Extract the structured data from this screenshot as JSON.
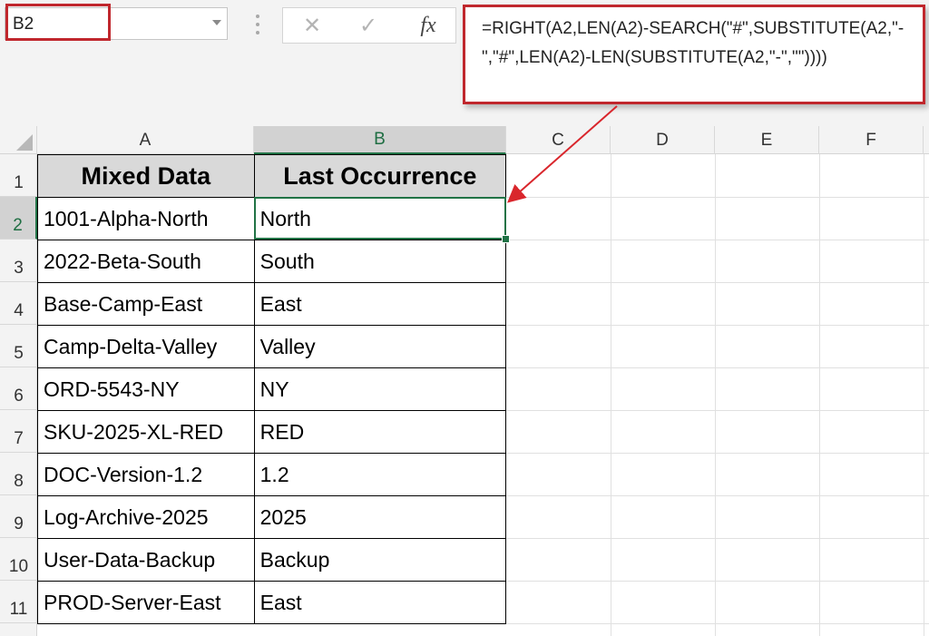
{
  "name_box": {
    "value": "B2"
  },
  "formula_bar": {
    "cancel_glyph": "✕",
    "enter_glyph": "✓",
    "function_glyph": "fx",
    "formula": "=RIGHT(A2,LEN(A2)-SEARCH(\"#\",SUBSTITUTE(A2,\"-\",\"#\",LEN(A2)-LEN(SUBSTITUTE(A2,\"-\",\"\"))))"
  },
  "column_headers": [
    "A",
    "B",
    "C",
    "D",
    "E",
    "F"
  ],
  "row_headers": [
    "1",
    "2",
    "3",
    "4",
    "5",
    "6",
    "7",
    "8",
    "9",
    "10",
    "11"
  ],
  "table": {
    "header": {
      "colA": "Mixed Data",
      "colB": "Last Occurrence"
    },
    "rows": [
      {
        "colA": "1001-Alpha-North",
        "colB": "North"
      },
      {
        "colA": "2022-Beta-South",
        "colB": "South"
      },
      {
        "colA": "Base-Camp-East",
        "colB": "East"
      },
      {
        "colA": "Camp-Delta-Valley",
        "colB": "Valley"
      },
      {
        "colA": "ORD-5543-NY",
        "colB": "NY"
      },
      {
        "colA": "SKU-2025-XL-RED",
        "colB": "RED"
      },
      {
        "colA": "DOC-Version-1.2",
        "colB": "1.2"
      },
      {
        "colA": "Log-Archive-2025",
        "colB": "2025"
      },
      {
        "colA": "User-Data-Backup",
        "colB": "Backup"
      },
      {
        "colA": "PROD-Server-East",
        "colB": "East"
      }
    ]
  },
  "colors": {
    "highlight": "#c0272d",
    "selection": "#217346",
    "header_fill": "#d9d9d9"
  }
}
